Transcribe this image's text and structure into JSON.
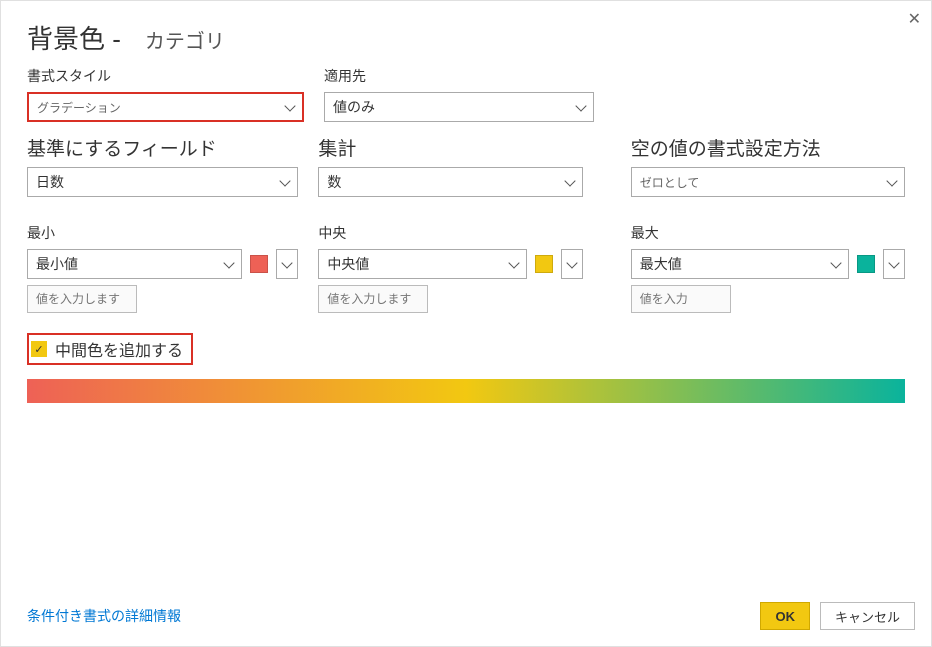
{
  "title": "背景色 -",
  "category_label": "カテゴリ",
  "close_glyph": "✕",
  "format_style": {
    "label": "書式スタイル",
    "value": "グラデーション"
  },
  "apply_to": {
    "label": "適用先",
    "value": "値のみ"
  },
  "base_field": {
    "label": "基準にするフィールド",
    "value": "日数"
  },
  "summarization": {
    "label": "集計",
    "value": "数"
  },
  "empty_values": {
    "label": "空の値の書式設定方法",
    "value": "ゼロとして"
  },
  "min": {
    "label": "最小",
    "select": "最小値",
    "placeholder": "値を入力します",
    "color": "#ee6156"
  },
  "center": {
    "label": "中央",
    "select": "中央値",
    "placeholder": "値を入力します",
    "color": "#f2c811"
  },
  "max": {
    "label": "最大",
    "select": "最大値",
    "placeholder": "値を入力",
    "color": "#0ab39c"
  },
  "diverging_checkbox": {
    "label": "中間色を追加する",
    "checked_glyph": "✓"
  },
  "footer": {
    "link": "条件付き書式の詳細情報",
    "ok": "OK",
    "cancel": "キャンセル"
  }
}
